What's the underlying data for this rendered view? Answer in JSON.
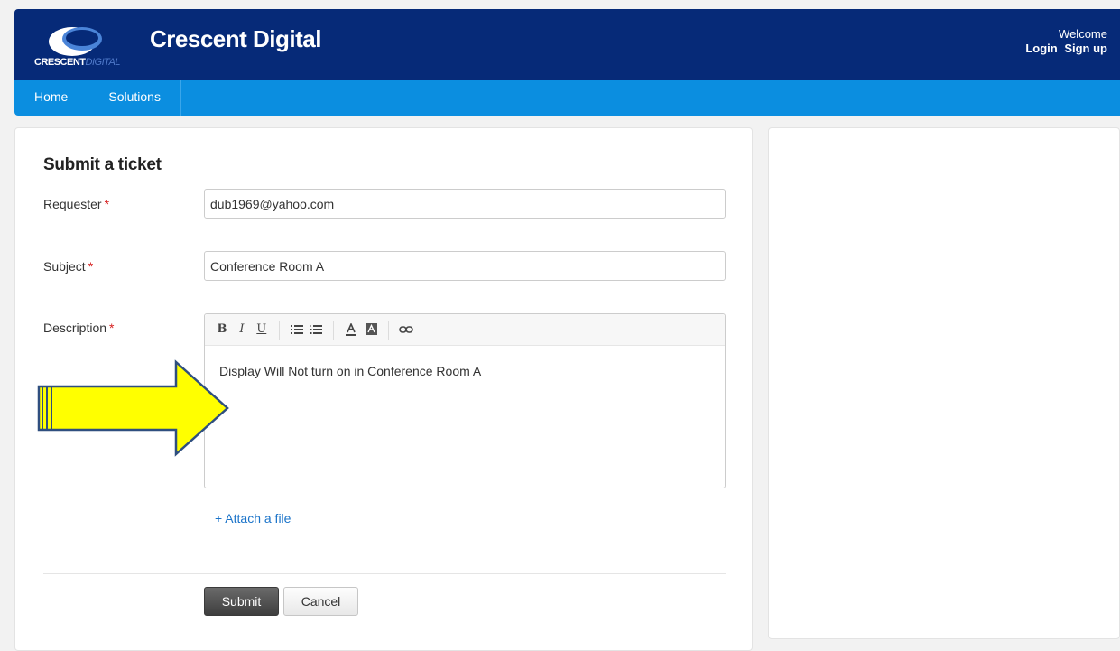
{
  "header": {
    "logo_text_main": "CRESCENT",
    "logo_text_sub": "DIGITAL",
    "brand_title": "Crescent Digital",
    "welcome_text": "Welcome",
    "login_label": "Login",
    "signup_label": "Sign up",
    "background_color": "#062a78"
  },
  "nav": {
    "items": [
      {
        "label": "Home"
      },
      {
        "label": "Solutions"
      }
    ],
    "background_color": "#0b8ee0"
  },
  "form": {
    "title": "Submit a ticket",
    "requester": {
      "label": "Requester",
      "value": "dub1969@yahoo.com"
    },
    "subject": {
      "label": "Subject",
      "value": "Conference Room A"
    },
    "description": {
      "label": "Description",
      "value": "Display Will Not turn on in Conference Room A"
    },
    "required_marker": "*",
    "toolbar": {
      "bold": "B",
      "italic": "I",
      "underline": "U",
      "unordered_list_icon": "bullet-list-icon",
      "ordered_list_icon": "numbered-list-icon",
      "font_color_icon": "font-color-icon",
      "background_color_icon": "background-color-icon",
      "link_icon": "link-icon"
    },
    "attach_label": "+ Attach a file",
    "submit_label": "Submit",
    "cancel_label": "Cancel"
  },
  "annotation": {
    "arrow_color": "#ffff00",
    "arrow_outline_color": "#2f4f7f"
  }
}
